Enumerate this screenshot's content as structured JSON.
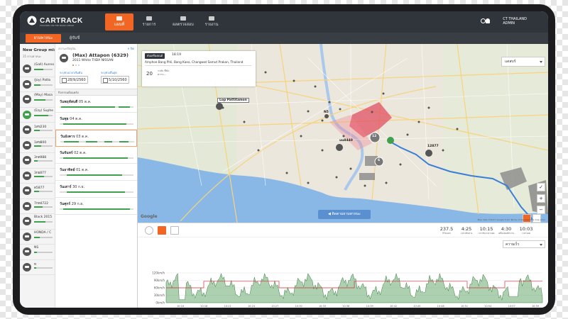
{
  "app": {
    "brand": "CARTRACK",
    "tagline": "FOCUSED ON THE ROAD AHEAD"
  },
  "nav": {
    "items": [
      {
        "label": "แผนที่",
        "icon": "map-icon",
        "active": true
      },
      {
        "label": "รายการ",
        "icon": "list-icon",
        "active": false
      },
      {
        "label": "ผลตรวจสอบ",
        "icon": "car-icon",
        "active": false
      },
      {
        "label": "รายงาน",
        "icon": "report-icon",
        "active": false
      }
    ],
    "user_company": "CT THAILAND",
    "user_name": "ADMIN"
  },
  "subtabs": [
    {
      "label": "ยานพาหนะ",
      "active": true
    },
    {
      "label": "ผู้ขับขี่",
      "active": false
    }
  ],
  "group": {
    "title": "New Group mix1",
    "subtitle": "35 ยานพาหนะ",
    "vehicles": [
      {
        "label": "(Gall) Aunno",
        "status": "grey",
        "progress": 0.5
      },
      {
        "label": "(Joy) Patto",
        "status": "grey",
        "progress": 0.35
      },
      {
        "label": "(May) Masa",
        "status": "grey",
        "progress": 0.6
      },
      {
        "label": "(Ezy) Suphe",
        "status": "green",
        "progress": 0.75
      },
      {
        "label": "1สข230",
        "status": "grey",
        "progress": 0.3
      },
      {
        "label": "1สข800",
        "status": "grey",
        "progress": 0.4
      },
      {
        "label": "3กด988",
        "status": "grey",
        "progress": 0.2
      },
      {
        "label": "3กย877",
        "status": "grey",
        "progress": 0.55
      },
      {
        "label": "ด5877",
        "status": "grey",
        "progress": 0.25
      },
      {
        "label": "7กท4722",
        "status": "grey",
        "progress": 0.45
      },
      {
        "label": "Black 2015",
        "status": "grey",
        "progress": 0.6
      },
      {
        "label": "HONDA / C",
        "status": "grey",
        "progress": 0.3
      },
      {
        "label": "NS",
        "status": "grey",
        "progress": 0.15
      },
      {
        "label": "ท",
        "status": "grey",
        "progress": 0.1
      }
    ]
  },
  "detail": {
    "header": "สถานะปัจจุบัน",
    "close_label": "× ปิด",
    "vehicle_name": "(Max) Attapon (6329)",
    "vehicle_desc": "2011 White TIIDA NISSAN",
    "from_label": "ระบุช่วงเวลาเริ่มต้น",
    "from_date": "28/9/2560",
    "to_label": "ระบุช่วงสิ้นสุด",
    "to_date": "5/10/2560",
    "section_title": "กิจกรรมย้อนหลัง",
    "days": [
      {
        "day": "วันพฤหัสบดี",
        "date": "05 ต.ค.",
        "segs": [
          [
            0.02,
            0.75
          ],
          [
            0.8,
            0.95
          ]
        ],
        "selected": false
      },
      {
        "day": "วันพุธ",
        "date": "04 ต.ค.",
        "segs": [
          [
            0.05,
            0.9
          ]
        ],
        "selected": false
      },
      {
        "day": "วันอังคาร",
        "date": "03 ต.ค.",
        "segs": [
          [
            0.05,
            0.25
          ],
          [
            0.35,
            0.5
          ],
          [
            0.6,
            0.7
          ],
          [
            0.8,
            0.92
          ]
        ],
        "selected": true
      },
      {
        "day": "วันจันทร์",
        "date": "02 ต.ค.",
        "segs": [
          [
            0.05,
            0.92
          ]
        ],
        "selected": false
      },
      {
        "day": "วันอาทิตย์",
        "date": "01 ต.ค.",
        "segs": [
          [
            0.1,
            0.85
          ]
        ],
        "selected": false
      },
      {
        "day": "วันเสาร์",
        "date": "30 ก.ย.",
        "segs": [
          [
            0.1,
            0.88
          ]
        ],
        "selected": false
      },
      {
        "day": "วันศุกร์",
        "date": "29 ก.ย.",
        "segs": [
          [
            0.05,
            0.95
          ]
        ],
        "selected": false
      }
    ]
  },
  "map": {
    "info_status": "ดับเครื่องยนต์",
    "info_time": "18:19",
    "info_address": "Amphoe Bang Phli, Bang Kaeo, Changwat Samut Prakan, Thailand",
    "info_speed": "20",
    "info_speed_unit": "ระดับ ที่ขับ",
    "info_extra": "ความ...",
    "view_select": "แดสบร์",
    "play_label": "◀ ติดตามยานพาหนะ",
    "google": "Google",
    "copyright": "Map data ©2017 Google   5 km   Terms of Use   Report a map error",
    "labels": [
      {
        "text": "Lop Pattitamon",
        "box": true
      },
      {
        "text": "N5",
        "box": false
      },
      {
        "text": "12",
        "box": false
      },
      {
        "text": "6",
        "box": false
      },
      {
        "text": "uu8440",
        "box": false
      },
      {
        "text": "12877",
        "box": false
      }
    ],
    "route_color": "#3a7fd5",
    "zone_color": "#e05060"
  },
  "stats": [
    {
      "value": "237.5",
      "label": "กิโลเมตร"
    },
    {
      "value": "4:25",
      "label": "เวลาเดินทาง"
    },
    {
      "value": "10:15",
      "label": "เวลาขับ/เวลาจอด"
    },
    {
      "value": "4:30",
      "label": "เครื่องยนต์ทำงาน"
    },
    {
      "value": "10:03",
      "label": "เวลาจอด"
    }
  ],
  "chart": {
    "metric_select": "ความเร็ว",
    "yticks": [
      "120km/h",
      "90km/h",
      "60km/h",
      "30km/h",
      "0km/h"
    ],
    "xticks": [
      "10:16",
      "10:18",
      "10:21",
      "10:24",
      "10:27",
      "10:30",
      "10:33",
      "10:36",
      "10:39",
      "10:42",
      "10:45",
      "10:48",
      "10:51",
      "10:54",
      "10:57",
      "10:59"
    ],
    "fill_color": "#4a9a4f",
    "limit_color": "#d0303a"
  }
}
